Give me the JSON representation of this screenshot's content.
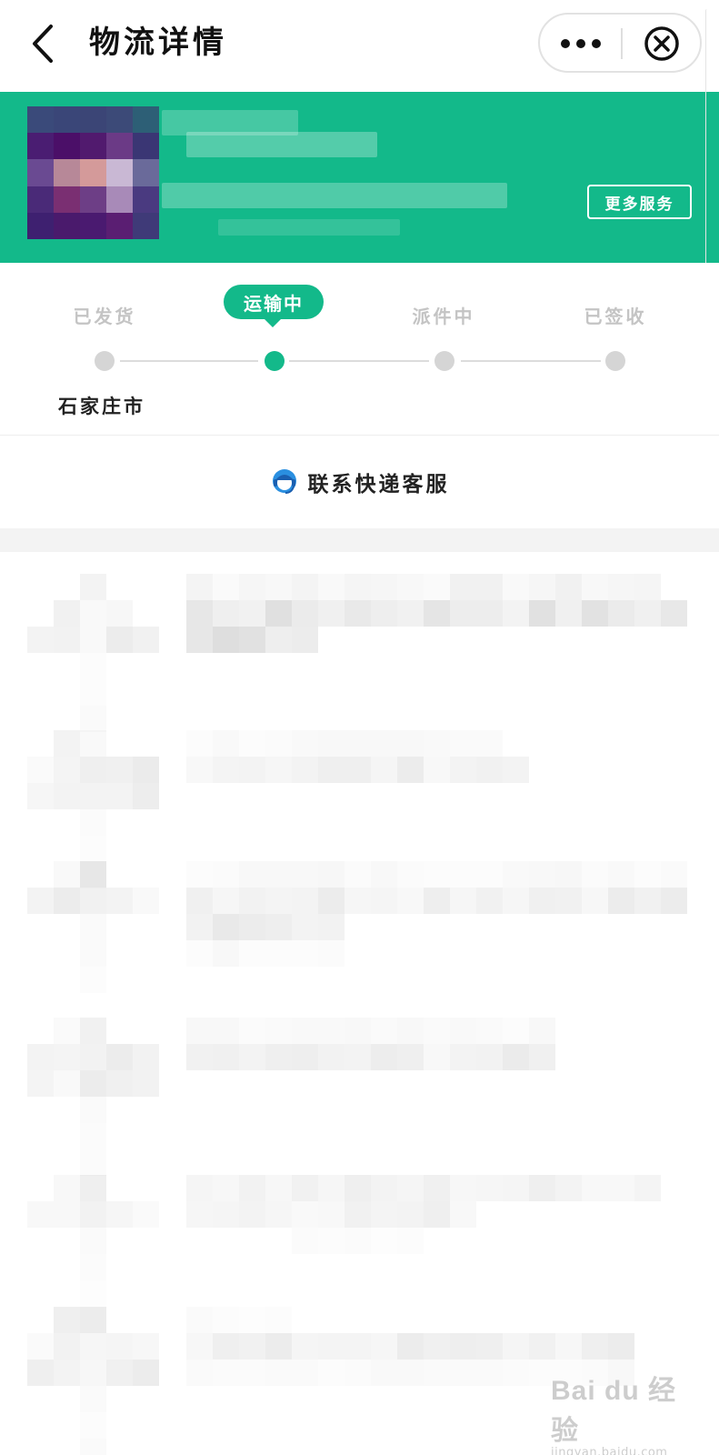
{
  "navbar": {
    "title": "物流详情",
    "back_icon": "chevron-left-icon",
    "more_icon": "ellipsis-icon",
    "close_icon": "circle-x-icon"
  },
  "header": {
    "background_color": "#13b98a",
    "more_services_label": "更多服务"
  },
  "progress": {
    "steps": [
      {
        "label": "已发货",
        "state": "done"
      },
      {
        "label": "运输中",
        "state": "current"
      },
      {
        "label": "派件中",
        "state": "pending"
      },
      {
        "label": "已签收",
        "state": "pending"
      }
    ],
    "current_city": "石家庄市"
  },
  "contact": {
    "label": "联系快递客服",
    "icon": "customer-service-icon"
  },
  "watermark": {
    "brand": "Bai du 经验",
    "url": "jingyan.baidu.com"
  },
  "colors": {
    "accent": "#13b98a",
    "inactive_step": "#c4c4c4",
    "page_bg": "#ffffff"
  }
}
